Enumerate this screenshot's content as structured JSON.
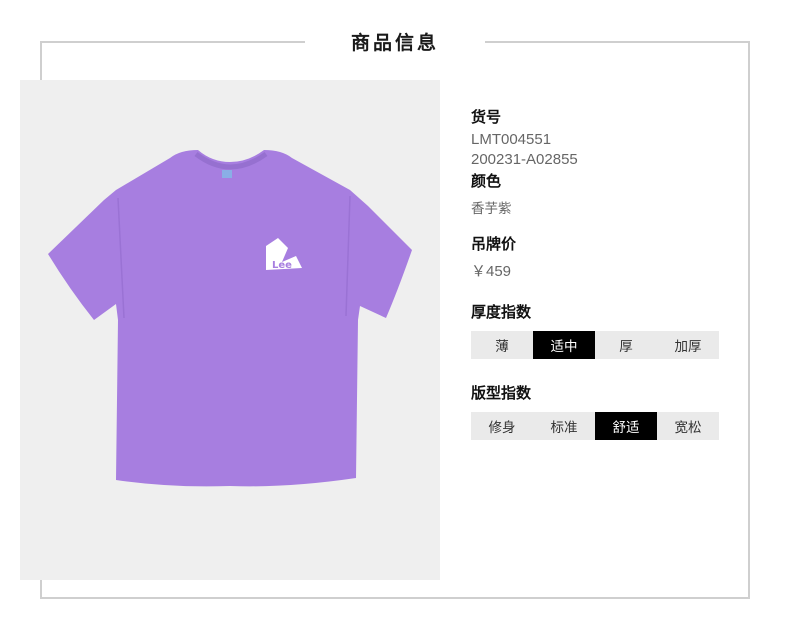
{
  "section": {
    "title": "商品信息"
  },
  "product": {
    "image_alt": "purple t-shirt with Lee logo",
    "shirt_color": "#a77ee0",
    "sku_label": "货号",
    "sku_values": [
      "LMT004551",
      "200231-A02855"
    ],
    "color_label": "颜色",
    "color_value": "香芋紫",
    "price_label": "吊牌价",
    "price_value": "￥459"
  },
  "thickness": {
    "label": "厚度指数",
    "options": [
      "薄",
      "适中",
      "厚",
      "加厚"
    ],
    "selected": "适中"
  },
  "fit": {
    "label": "版型指数",
    "options": [
      "修身",
      "标准",
      "舒适",
      "宽松"
    ],
    "selected": "舒适"
  }
}
